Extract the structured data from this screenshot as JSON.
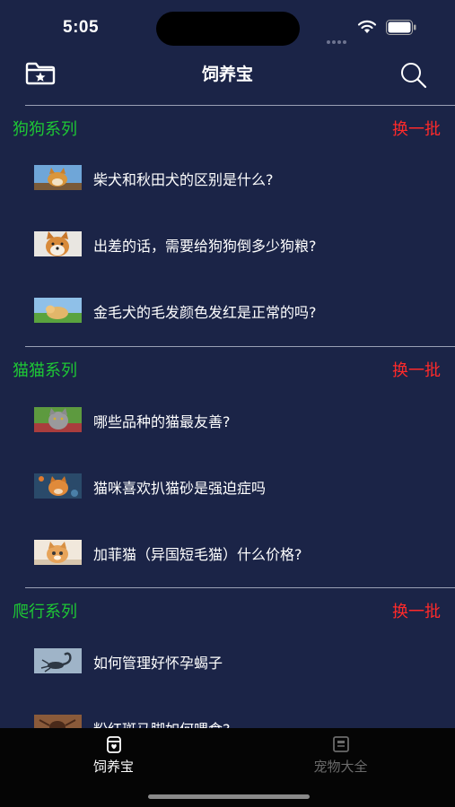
{
  "status": {
    "time": "5:05"
  },
  "nav": {
    "title": "饲养宝",
    "left_icon": "folder-star-icon",
    "right_icon": "search-icon"
  },
  "sections": [
    {
      "title": "狗狗系列",
      "refresh_label": "换一批",
      "items": [
        {
          "text": "柴犬和秋田犬的区别是什么?",
          "thumb": "shiba"
        },
        {
          "text": "出差的话，需要给狗狗倒多少狗粮?",
          "thumb": "shiba-face"
        },
        {
          "text": "金毛犬的毛发颜色发红是正常的吗?",
          "thumb": "golden"
        }
      ]
    },
    {
      "title": "猫猫系列",
      "refresh_label": "换一批",
      "items": [
        {
          "text": "哪些品种的猫最友善?",
          "thumb": "grey-cat"
        },
        {
          "text": "猫咪喜欢扒猫砂是强迫症吗",
          "thumb": "orange-cat"
        },
        {
          "text": "加菲猫（异国短毛猫）什么价格?",
          "thumb": "exotic-cat"
        }
      ]
    },
    {
      "title": "爬行系列",
      "refresh_label": "换一批",
      "items": [
        {
          "text": "如何管理好怀孕蝎子",
          "thumb": "scorpion"
        },
        {
          "text": "粉红斑马脚如何喂食?",
          "thumb": "tarantula"
        }
      ]
    }
  ],
  "tabs": [
    {
      "label": "饲养宝",
      "icon": "feeder-icon",
      "active": true
    },
    {
      "label": "宠物大全",
      "icon": "pet-book-icon",
      "active": false
    }
  ],
  "colors": {
    "background": "#1b2447",
    "section_title": "#1ec735",
    "refresh": "#ff2a2a",
    "tab_inactive": "#6b6b6b"
  }
}
